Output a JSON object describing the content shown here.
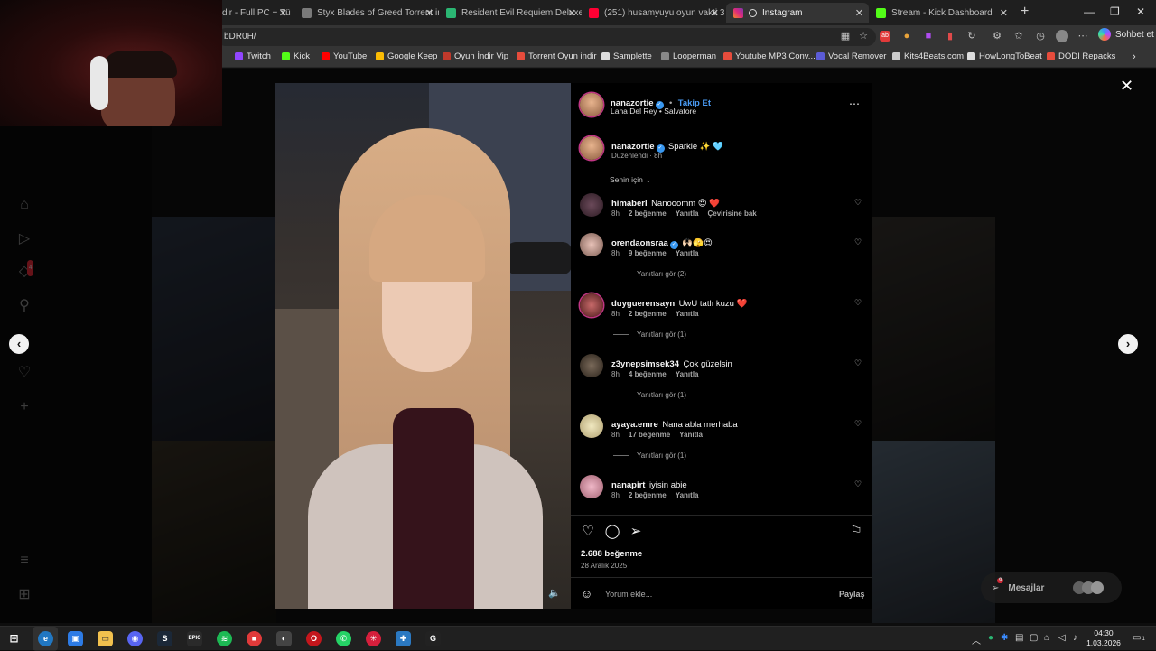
{
  "browser": {
    "tabs": [
      {
        "label": "dir - Full PC + Tü",
        "color": "#4f8df5"
      },
      {
        "label": "Styx Blades of Greed Torrent indir",
        "color": "#9a9a9a"
      },
      {
        "label": "Resident Evil Requiem Deluxe +2 (",
        "color": "#2bb673"
      },
      {
        "label": "(251) husamyuyu oyun vakti 3 - Yo",
        "color": "#ff0033"
      },
      {
        "label": "Instagram",
        "color": "#e1306c"
      },
      {
        "label": "Stream - Kick Dashboard",
        "color": "#53fc18"
      }
    ],
    "url": "bDR0H/",
    "chat_label": "Sohbet et",
    "bookmarks": [
      {
        "label": "Twitch",
        "color": "#9146ff"
      },
      {
        "label": "Kick",
        "color": "#53fc18"
      },
      {
        "label": "YouTube",
        "color": "#ff0000"
      },
      {
        "label": "Google Keep",
        "color": "#fbbc04"
      },
      {
        "label": "Oyun İndir Vip",
        "color": "#c0392b"
      },
      {
        "label": "Torrent Oyun indir",
        "color": "#e74c3c"
      },
      {
        "label": "Samplette",
        "color": "#dddddd"
      },
      {
        "label": "Looperman",
        "color": "#888888"
      },
      {
        "label": "Youtube MP3 Conv...",
        "color": "#e74c3c"
      },
      {
        "label": "Vocal Remover",
        "color": "#5b5bd6"
      },
      {
        "label": "Kits4Beats.com",
        "color": "#cccccc"
      },
      {
        "label": "HowLongToBeat",
        "color": "#dddddd"
      },
      {
        "label": "DODI Repacks",
        "color": "#e74c3c"
      }
    ]
  },
  "sidebar": {
    "notification_count": "4"
  },
  "post": {
    "author": "nanazortie",
    "follow_label": "Takip Et",
    "separator": "•",
    "audio": "Lana Del Rey • Salvatore",
    "caption_text": "Sparkle ✨ 🩵",
    "caption_meta": "Düzenlendi · 8h",
    "sort_label": "Senin için",
    "likes": "2.688 beğenme",
    "date": "28 Aralık 2025",
    "comment_placeholder": "Yorum ekle...",
    "share_label": "Paylaş"
  },
  "comments": [
    {
      "user": "himaberl",
      "text": "Nanooomm 😍 ❤️",
      "time": "8h",
      "likes": "2 beğenme",
      "reply": "Yanıtla",
      "translate": "Çevirisine bak",
      "replies": ""
    },
    {
      "user": "orendaonsraa",
      "verified": true,
      "text": "🙌🏻🫣😍",
      "time": "8h",
      "likes": "9 beğenme",
      "reply": "Yanıtla",
      "translate": "",
      "replies": "Yanıtları gör (2)"
    },
    {
      "user": "duyguerensayn",
      "text": "UwU tatlı kuzu ❤️",
      "time": "8h",
      "likes": "2 beğenme",
      "reply": "Yanıtla",
      "translate": "",
      "replies": "Yanıtları gör (1)"
    },
    {
      "user": "z3ynepsimsek34",
      "text": "Çok güzelsin",
      "time": "8h",
      "likes": "4 beğenme",
      "reply": "Yanıtla",
      "translate": "",
      "replies": "Yanıtları gör (1)"
    },
    {
      "user": "ayaya.emre",
      "text": "Nana abla merhaba",
      "time": "8h",
      "likes": "17 beğenme",
      "reply": "Yanıtla",
      "translate": "",
      "replies": "Yanıtları gör (1)"
    },
    {
      "user": "nanapirt",
      "text": "iyisin abie",
      "time": "8h",
      "likes": "2 beğenme",
      "reply": "Yanıtla",
      "translate": "",
      "replies": ""
    }
  ],
  "messages_label": "Mesajlar",
  "messages_badge": "9",
  "taskbar": {
    "time": "04:30",
    "date": "1.03.2026",
    "notification_count": "1"
  }
}
